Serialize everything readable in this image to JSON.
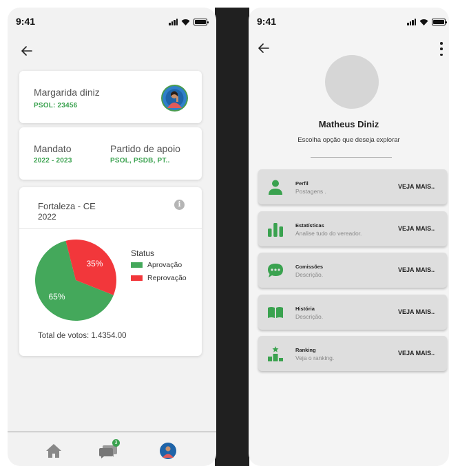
{
  "colors": {
    "accent_green": "#3aa24f",
    "pie_red": "#f2373b",
    "pie_green": "#44a85b"
  },
  "left": {
    "status_time": "9:41",
    "profile": {
      "name": "Margarida diniz",
      "party_line": "PSOL:  23456"
    },
    "mandate": {
      "title": "Mandato",
      "value": "2022 - 2023"
    },
    "support": {
      "title": "Partido de apoio",
      "value": "PSOL, PSDB, PT.."
    },
    "stats": {
      "location": "Fortaleza - CE",
      "year": "2022",
      "total_label": "Total de votos:",
      "total_value": "1.4354.00"
    },
    "nav_badge": "3"
  },
  "chart_data": {
    "type": "pie",
    "title": "",
    "legend_title": "Status",
    "legend_position": "right",
    "categories": [
      "Aprovação",
      "Reprovação"
    ],
    "values": [
      65,
      35
    ],
    "labels": [
      "65%",
      "35%"
    ],
    "colors": [
      "#44a85b",
      "#f2373b"
    ]
  },
  "right": {
    "status_time": "9:41",
    "name": "Matheus Diniz",
    "subtitle": "Escolha opção que deseja explorar",
    "menu": [
      {
        "title": "Perfil",
        "subtitle": "Postagens .",
        "action": "VEJA MAIS..",
        "icon": "person-icon"
      },
      {
        "title": "Estatísticas",
        "subtitle": "Analise tudo do vereador.",
        "action": "VEJA MAIS..",
        "icon": "bar-chart-icon"
      },
      {
        "title": "Comissões",
        "subtitle": "Descrição.",
        "action": "VEJA MAIS..",
        "icon": "chat-bubble-icon"
      },
      {
        "title": "História",
        "subtitle": "Descrição.",
        "action": "VEJA MAIS..",
        "icon": "book-icon"
      },
      {
        "title": "Ranking",
        "subtitle": "Veja o ranking.",
        "action": "VEJA MAIS..",
        "icon": "podium-icon"
      }
    ]
  }
}
